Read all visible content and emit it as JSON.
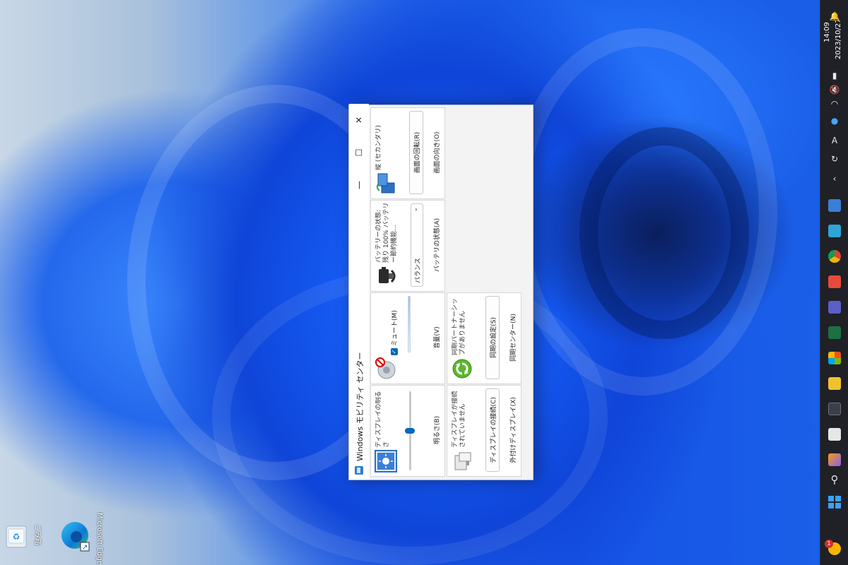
{
  "window": {
    "title": "Windows モビリティ センター",
    "minimize": "—",
    "maximize": "☐",
    "close": "✕"
  },
  "tiles": {
    "brightness": {
      "text": "ディスプレイの明るさ",
      "caption": "明るさ(B)",
      "level_percent": 50
    },
    "volume": {
      "mute_label": "ミュート(M)",
      "mute_checked": true,
      "caption": "音量(V)"
    },
    "battery": {
      "text": "バッテリーの状態: 残り 100% バッテリー節約機能...",
      "plan": "バランス",
      "caption": "バッテリの状態(A)"
    },
    "rotation": {
      "text": "縦 (セカンダリ)",
      "button": "画面の回転(R)",
      "caption": "画面の向き(O)"
    },
    "display": {
      "text": "ディスプレイが接続されていません",
      "button": "ディスプレイの接続(C)",
      "caption": "外付けディスプレイ(X)"
    },
    "sync": {
      "text": "同期パートナーシップがありません",
      "button": "同期の設定(S)",
      "caption": "同期センター(N)"
    }
  },
  "desktop": {
    "icons": [
      {
        "label": "ごみ箱",
        "icon": "recycle-bin-icon"
      },
      {
        "label": "Microsoft Edge",
        "icon": "edge-icon"
      }
    ]
  },
  "taskbar": {
    "time": "14:09",
    "date": "2023/10/27",
    "tray_letter": "A",
    "badge_count": "1",
    "colors": {
      "background": "#1f2126",
      "accent": "#0067c0"
    }
  }
}
